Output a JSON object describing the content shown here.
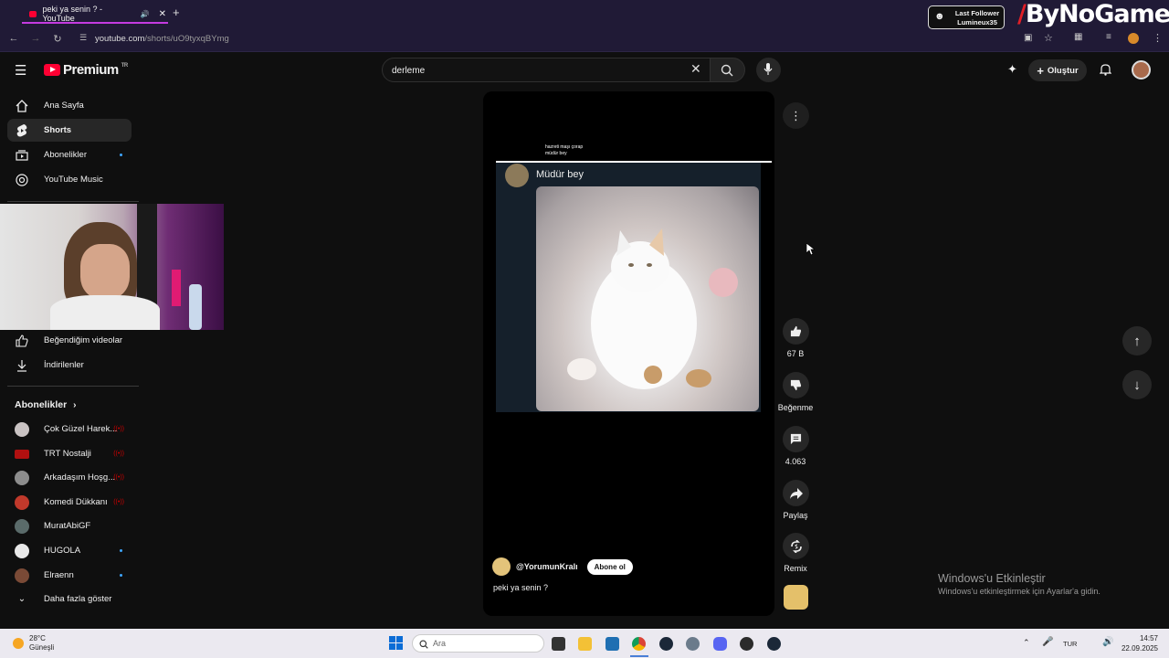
{
  "browser": {
    "tab_title": "peki ya senin ? - YouTube",
    "url_host": "youtube.com",
    "url_path": "/shorts/uO9tyxqBYmg",
    "overlay_follower_title": "Last Follower",
    "overlay_follower_name": "Lumineux35",
    "overlay_logo": "ByNoGame"
  },
  "yt": {
    "logo_text": "Premium",
    "logo_region": "TR",
    "search_value": "derleme",
    "create_label": "Oluştur"
  },
  "sidebar": {
    "items": [
      {
        "label": "Ana Sayfa"
      },
      {
        "label": "Shorts"
      },
      {
        "label": "Abonelikler"
      },
      {
        "label": "YouTube Music"
      }
    ],
    "you_items": [
      {
        "label": "Beğendiğim videolar"
      },
      {
        "label": "İndirilenler"
      }
    ],
    "subs_title": "Abonelikler",
    "channels": [
      {
        "name": "Çok Güzel Harek...",
        "live": "((•))"
      },
      {
        "name": "TRT Nostalji",
        "live": "((•))"
      },
      {
        "name": "Arkadaşım Hoşg...",
        "live": "((•))"
      },
      {
        "name": "Komedi Dükkanı",
        "live": "((•))"
      },
      {
        "name": "MuratAbiGF",
        "live": ""
      },
      {
        "name": "HUGOLA",
        "live": ""
      },
      {
        "name": "Elraenn",
        "live": ""
      }
    ],
    "more_label": "Daha fazla göster"
  },
  "short": {
    "header_line1": "hazreti maşı çorap",
    "header_line2": "müdür bey",
    "tweet_text": "Müdür bey",
    "channel": "@YorumunKralı",
    "subscribe_label": "Abone ol",
    "caption": "peki ya senin ?"
  },
  "actions": {
    "likes": "67 B",
    "dislike": "Beğenme",
    "comments": "4.063",
    "share": "Paylaş",
    "remix": "Remix"
  },
  "windows": {
    "activate_title": "Windows'u Etkinleştir",
    "activate_sub": "Windows'u etkinleştirmek için Ayarlar'a gidin.",
    "temp": "28°C",
    "weather": "Güneşli",
    "search_placeholder": "Ara",
    "lang": "TUR",
    "time": "14:57",
    "date": "22.09.2025"
  },
  "colors": {
    "accent": "#ff0033",
    "tab_underline": "#c43be0",
    "blue_dot": "#3ea6ff"
  }
}
